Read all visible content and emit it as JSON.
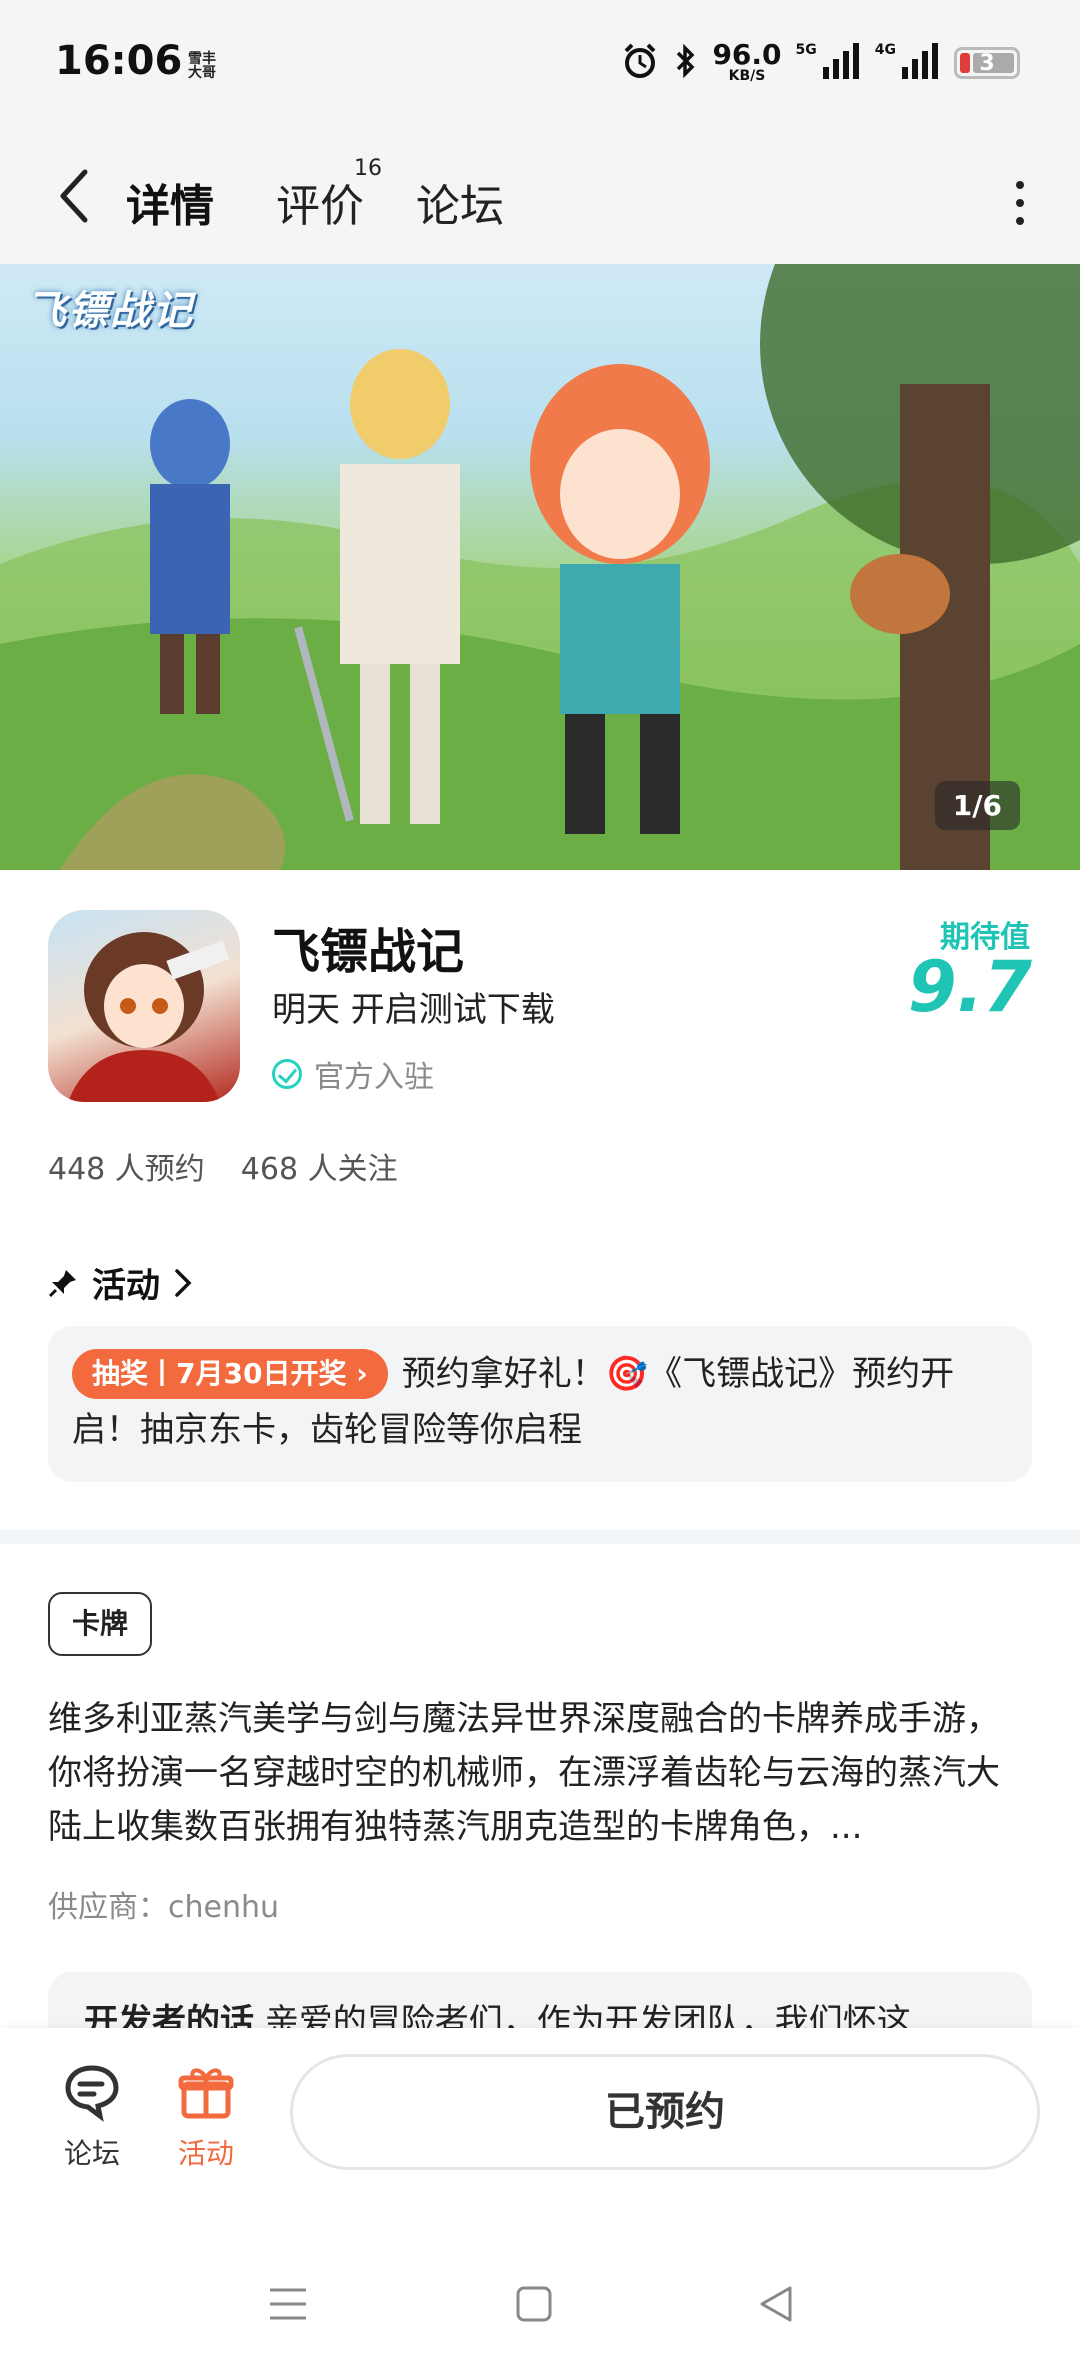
{
  "status_bar": {
    "time": "16:06",
    "carrier_mini": "雪丰\n大哥",
    "net_speed": "96.0",
    "net_unit": "KB/S",
    "signal1_label": "5G",
    "signal2_label": "4G",
    "battery": "3"
  },
  "nav": {
    "tabs": [
      {
        "label": "详情",
        "active": true
      },
      {
        "label": "评价",
        "badge": "16"
      },
      {
        "label": "论坛"
      }
    ]
  },
  "banner": {
    "logo_text": "飞镖战记",
    "pager": "1/6"
  },
  "app": {
    "name": "飞镖战记",
    "subtitle": "明天 开启测试下载",
    "official": "官方入驻",
    "expect_label": "期待值",
    "expect_score": "9.7",
    "reservations": "448 人预约",
    "followers": "468 人关注"
  },
  "activity": {
    "title": "活动",
    "tag": "抽奖丨7月30日开奖",
    "text": "预约拿好礼！🎯《飞镖战记》预约开启！抽京东卡，齿轮冒险等你启程"
  },
  "description": {
    "genre": "卡牌",
    "text": "维多利亚蒸汽美学与剑与魔法异世界深度融合的卡牌养成手游，你将扮演一名穿越时空的机械师，在漂浮着齿轮与云海的蒸汽大陆上收集数百张拥有独特蒸汽朋克造型的卡牌角色，...",
    "supplier": "供应商：chenhu",
    "dev_title": "开发者的话",
    "dev_text": "亲爱的冒险者们，作为开发团队，我们怀这"
  },
  "bottom_bar": {
    "forum_label": "论坛",
    "activity_label": "活动",
    "reserve_label": "已预约"
  },
  "colors": {
    "accent": "#25d1c0",
    "score": "#1fc4b4",
    "orange": "#f26a3d"
  }
}
